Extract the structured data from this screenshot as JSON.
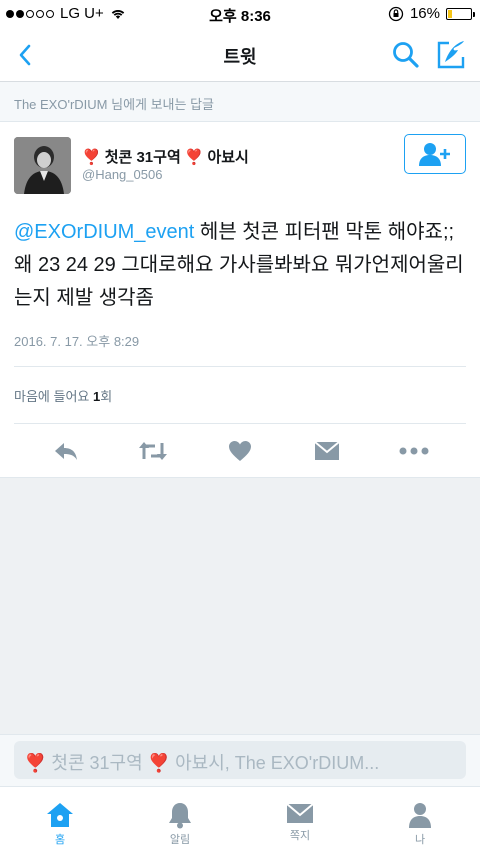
{
  "status_bar": {
    "carrier": "LG U+",
    "time": "오후 8:36",
    "battery": "16%",
    "battery_level": 0.16,
    "battery_color": "#f5c518"
  },
  "nav": {
    "title": "트윗",
    "back_icon": "chevron-left-icon",
    "search_icon": "search-icon",
    "compose_icon": "compose-icon",
    "accent": "#1da1f2"
  },
  "reply_context": "The EXO'rDIUM 님에게 보내는 답글",
  "tweet": {
    "user": {
      "name_prefix_emoji": "❣️",
      "name_main": "첫콘 31구역",
      "name_mid_emoji": "❣️",
      "name_suffix": "아뵤시",
      "handle": "@Hang_0506"
    },
    "mention": "@EXOrDIUM_event",
    "body": " 헤븐 첫콘 피터팬 막톤 해야죠;; 왜 23 24 29 그대로해요 가사를봐봐요 뭐가언제어울리는지 제발 생각좀",
    "timestamp": "2016. 7. 17. 오후 8:29",
    "likes_label": "마음에 들어요",
    "likes_count": "1",
    "likes_suffix": "회"
  },
  "actions": [
    {
      "name": "reply-icon"
    },
    {
      "name": "retweet-icon"
    },
    {
      "name": "heart-icon"
    },
    {
      "name": "direct-message-icon"
    },
    {
      "name": "more-icon"
    }
  ],
  "reply_bar": {
    "placeholder": "❣️ 첫콘 31구역 ❣️ 아뵤시, The EXO'rDIUM..."
  },
  "tabs": [
    {
      "label": "홈",
      "icon": "home-icon",
      "active": true
    },
    {
      "label": "알림",
      "icon": "bell-icon",
      "active": false
    },
    {
      "label": "쪽지",
      "icon": "envelope-icon",
      "active": false
    },
    {
      "label": "나",
      "icon": "person-icon",
      "active": false
    }
  ]
}
